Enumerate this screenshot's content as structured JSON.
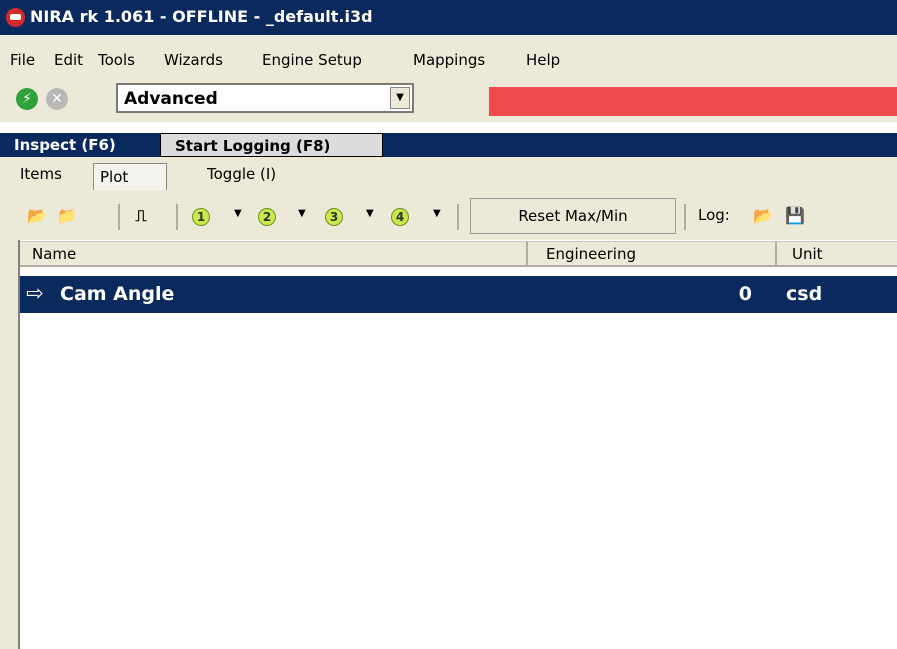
{
  "window": {
    "title": "NIRA rk 1.061 - OFFLINE - _default.i3d"
  },
  "menu": [
    "File",
    "Edit",
    "Tools",
    "Wizards",
    "Engine Setup",
    "Mappings",
    "Help"
  ],
  "toolbar": {
    "mode_value": "Advanced",
    "status_color": "#f2494a"
  },
  "tool_tabs": {
    "inspect": "Inspect (F6)",
    "start_logging": "Start Logging (F8)"
  },
  "sub_tabs": {
    "items": "Items",
    "plot": "Plot",
    "toggle": "Toggle (I)"
  },
  "list_toolbar": {
    "groups": [
      "1",
      "2",
      "3",
      "4"
    ],
    "reset_label": "Reset Max/Min",
    "log_label": "Log:"
  },
  "columns": {
    "name": "Name",
    "engineering": "Engineering",
    "unit": "Unit"
  },
  "rows": [
    {
      "name": "Cam Angle",
      "engineering": "0",
      "unit": "csd"
    }
  ],
  "colors": {
    "title_bg": "#0a2a5e",
    "chrome_bg": "#ece9d8",
    "status_red": "#f2494a",
    "selection_bg": "#0a2a5e"
  },
  "icons": [
    "app-icon",
    "connect-icon",
    "disconnect-icon",
    "add-item-icon",
    "open-folder-icon",
    "pulse-icon",
    "save-icon"
  ]
}
